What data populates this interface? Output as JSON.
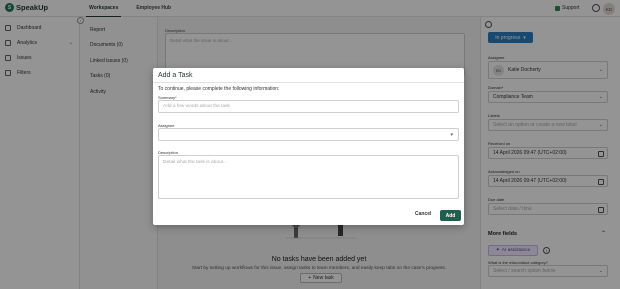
{
  "app": {
    "logo_text": "SpeakUp"
  },
  "top_tabs": [
    {
      "label": "Workspaces"
    },
    {
      "label": "Employee Hub"
    }
  ],
  "top_right": {
    "support_label": "Support",
    "avatar_initials": "KD"
  },
  "sidebar": {
    "items": [
      {
        "label": "Dashboard"
      },
      {
        "label": "Analytics"
      },
      {
        "label": "Issues"
      },
      {
        "label": "Filters"
      }
    ]
  },
  "inner_nav": {
    "collapse_glyph": "‹",
    "items": [
      {
        "label": "Report"
      },
      {
        "label": "Documents (0)"
      },
      {
        "label": "Linked issues (0)"
      },
      {
        "label": "Tasks (0)"
      },
      {
        "label": "Activity"
      }
    ]
  },
  "main": {
    "description_label": "Description",
    "description_placeholder": "Detail what the issue is about...",
    "empty_title": "No tasks have been added yet",
    "empty_subtitle": "Start by setting up workflows for this issue, assign tasks to team members, and easily keep tabs on the case's progress.",
    "new_task_label": "New task"
  },
  "right_panel": {
    "status_label": "In progress",
    "assignee_label": "Assignee",
    "assignee_initials": "KD",
    "assignee_name": "Katie Docherty",
    "domain_label": "Domain*",
    "domain_value": "Compliance Team",
    "labels_label": "Labels",
    "labels_placeholder": "Select an option or create a new label",
    "received_label": "Received on",
    "received_value": "14 April 2026 09:47 (UTC+02:00)",
    "acknowledged_label": "Acknowledged on",
    "acknowledged_value": "14 April 2026 09:47 (UTC+02:00)",
    "due_label": "Due date",
    "due_placeholder": "Select date / time",
    "more_fields_label": "More fields",
    "ai_button_label": "AI assistance",
    "category_label": "What is the misconduct category?",
    "category_placeholder": "Select / search option below"
  },
  "modal": {
    "title": "Add a Task",
    "intro": "To continue, please complete the following information:",
    "summary_label": "Summary*",
    "summary_placeholder": "Add a few words about the task",
    "assignee_label": "Assignee",
    "description_label": "Description",
    "description_placeholder": "Detail what the task is about...",
    "cancel_label": "Cancel",
    "add_label": "Add"
  },
  "colors": {
    "brand": "#1f5f4c",
    "status_blue": "#2d7fc1",
    "ai_purple": "#5a3fa8"
  }
}
